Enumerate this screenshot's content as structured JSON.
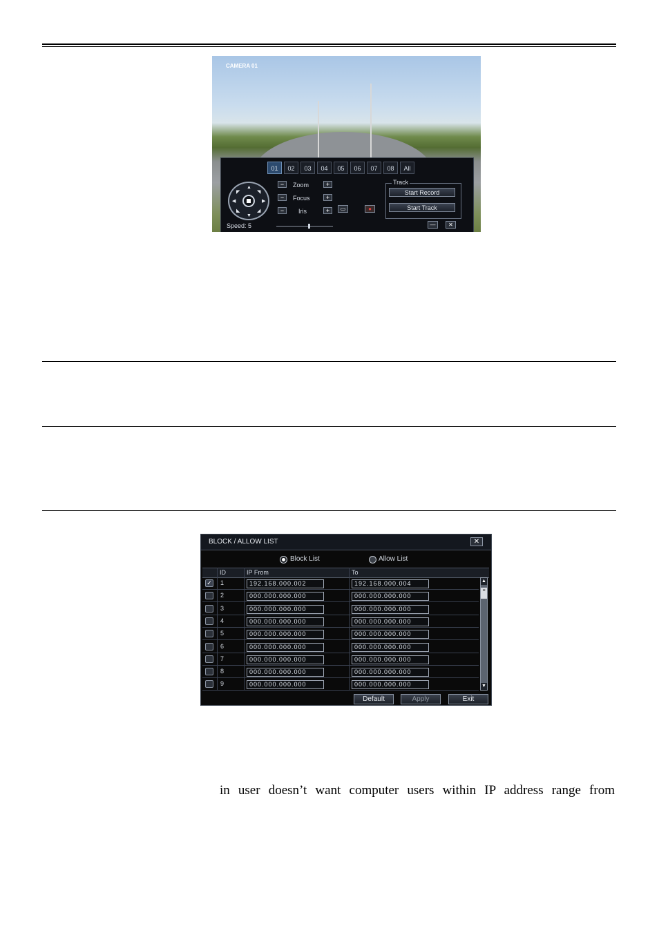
{
  "ptz": {
    "camera_label": "CAMERA 01",
    "channels": [
      "01",
      "02",
      "03",
      "04",
      "05",
      "06",
      "07",
      "08",
      "All"
    ],
    "selected_channel": "01",
    "zoom_label": "Zoom",
    "focus_label": "Focus",
    "iris_label": "Iris",
    "track_group_label": "Track",
    "start_record_label": "Start Record",
    "start_track_label": "Start Track",
    "speed_label": "Speed: 5",
    "speed_value": 5,
    "minimize_symbol": "—",
    "close_symbol": "✕"
  },
  "dialog": {
    "title": "BLOCK / ALLOW LIST",
    "close_symbol": "✕",
    "block_list_label": "Block List",
    "allow_list_label": "Allow List",
    "selected_mode": "Block List",
    "columns": [
      "ID",
      "IP From",
      "To"
    ],
    "rows": [
      {
        "id": "1",
        "checked": true,
        "from": "192.168.000.002",
        "to": "192.168.000.004"
      },
      {
        "id": "2",
        "checked": false,
        "from": "000.000.000.000",
        "to": "000.000.000.000"
      },
      {
        "id": "3",
        "checked": false,
        "from": "000.000.000.000",
        "to": "000.000.000.000"
      },
      {
        "id": "4",
        "checked": false,
        "from": "000.000.000.000",
        "to": "000.000.000.000"
      },
      {
        "id": "5",
        "checked": false,
        "from": "000.000.000.000",
        "to": "000.000.000.000"
      },
      {
        "id": "6",
        "checked": false,
        "from": "000.000.000.000",
        "to": "000.000.000.000"
      },
      {
        "id": "7",
        "checked": false,
        "from": "000.000.000.000",
        "to": "000.000.000.000"
      },
      {
        "id": "8",
        "checked": false,
        "from": "000.000.000.000",
        "to": "000.000.000.000"
      },
      {
        "id": "9",
        "checked": false,
        "from": "000.000.000.000",
        "to": "000.000.000.000"
      }
    ],
    "default_label": "Default",
    "apply_label": "Apply",
    "exit_label": "Exit"
  },
  "body_text": "in  user  doesn’t  want  computer  users  within  IP  address  range  from"
}
